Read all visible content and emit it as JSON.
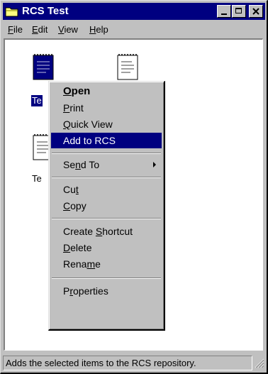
{
  "window": {
    "title": "RCS Test"
  },
  "menubar": {
    "items": [
      {
        "pre": "",
        "key": "F",
        "post": "ile"
      },
      {
        "pre": "",
        "key": "E",
        "post": "dit"
      },
      {
        "pre": "",
        "key": "V",
        "post": "iew"
      },
      {
        "pre": "",
        "key": "H",
        "post": "elp"
      }
    ]
  },
  "files": {
    "selected_label": "Te",
    "third_label": "Te"
  },
  "context_menu": {
    "items": [
      {
        "pre": "",
        "key": "O",
        "post": "pen"
      },
      {
        "pre": "",
        "key": "P",
        "post": "rint"
      },
      {
        "pre": "",
        "key": "Q",
        "post": "uick View"
      },
      {
        "label": "Add to RCS"
      },
      {
        "pre": "Se",
        "key": "n",
        "post": "d To"
      },
      {
        "pre": "Cu",
        "key": "t",
        "post": ""
      },
      {
        "pre": "",
        "key": "C",
        "post": "opy"
      },
      {
        "pre": "Create ",
        "key": "S",
        "post": "hortcut"
      },
      {
        "pre": "",
        "key": "D",
        "post": "elete"
      },
      {
        "pre": "Rena",
        "key": "m",
        "post": "e"
      },
      {
        "pre": "P",
        "key": "r",
        "post": "operties"
      }
    ]
  },
  "statusbar": {
    "text": "Adds the selected items to the RCS repository."
  },
  "colors": {
    "titlebar": "#000080",
    "highlight": "#000080",
    "face": "#c0c0c0"
  }
}
